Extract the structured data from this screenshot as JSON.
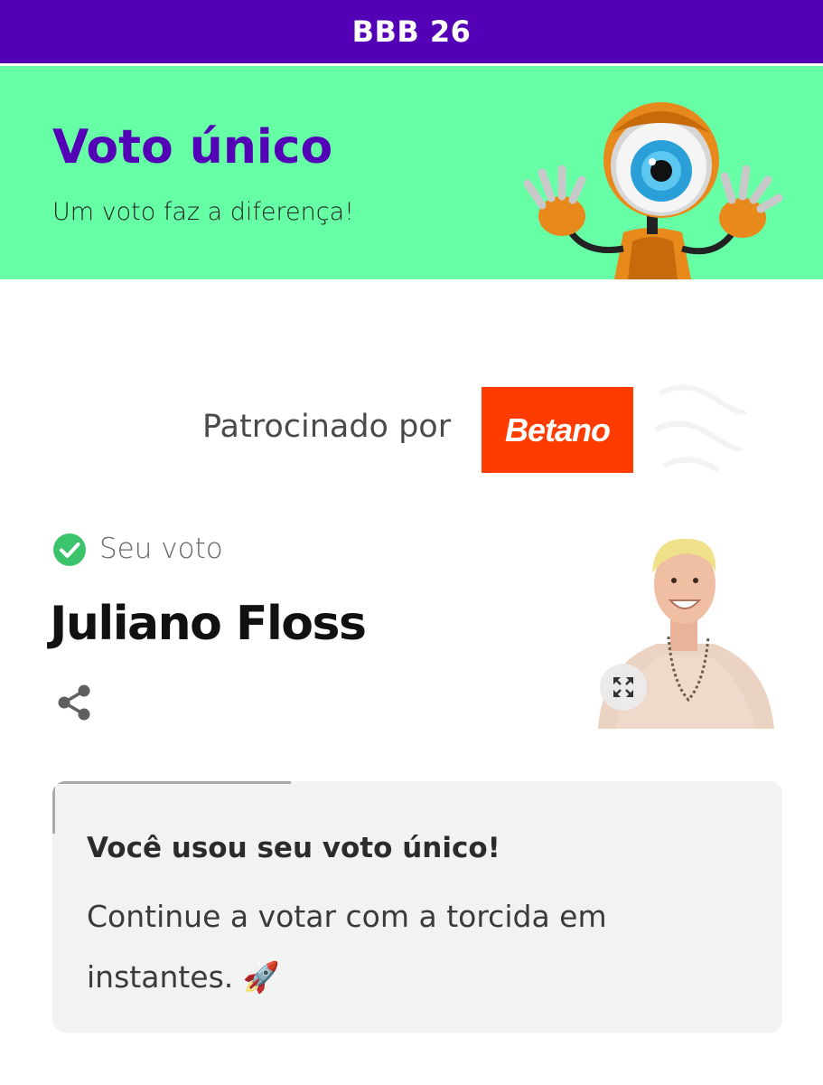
{
  "header": {
    "title": "BBB 26"
  },
  "banner": {
    "title": "Voto único",
    "subtitle": "Um voto faz a diferença!",
    "mascot_icon": "big-brother-eye-robot-mascot"
  },
  "sponsor": {
    "label": "Patrocinado por",
    "brand": "Betano",
    "brand_color": "#ff3b00"
  },
  "vote": {
    "status_label": "Seu voto",
    "status_icon": "check-circle-icon",
    "candidate_name": "Juliano Floss",
    "share_icon": "share-icon",
    "expand_icon": "expand-icon"
  },
  "notice": {
    "title": "Você usou seu voto único!",
    "body": "Continue a votar com a torcida em instantes. 🚀"
  },
  "colors": {
    "header_bg": "#5300b6",
    "banner_bg": "#66ffa6",
    "accent_purple": "#5300b6",
    "check_green": "#3cc46d"
  }
}
